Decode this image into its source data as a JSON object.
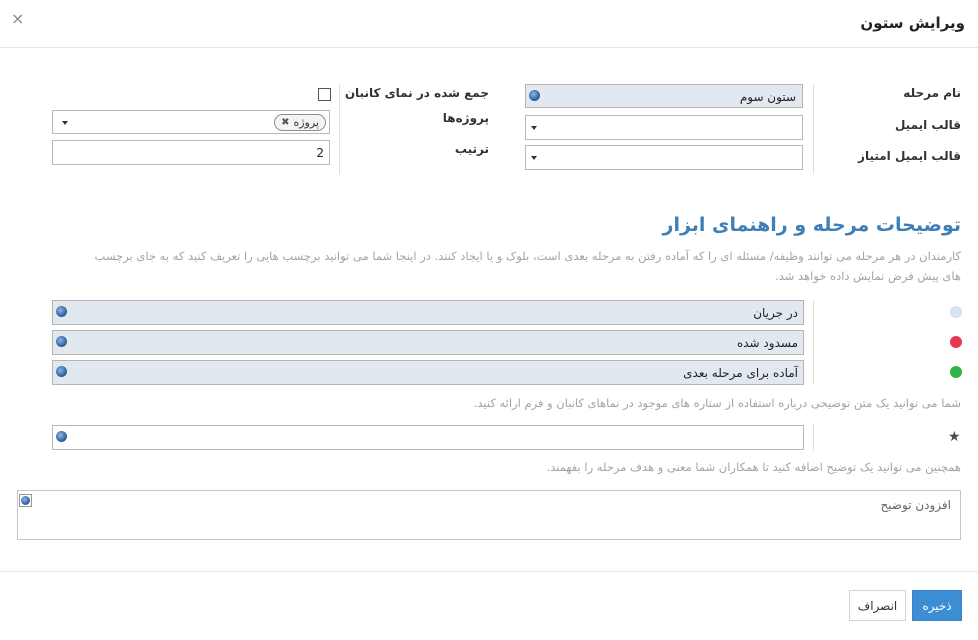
{
  "dialog": {
    "title": "ویرایش ستون",
    "close_symbol": "×"
  },
  "form": {
    "stage_name_label": "نام مرحله",
    "stage_name_value": "ستون سوم",
    "email_template_label": "قالب ایمیل",
    "rating_email_template_label": "قالب ایمیل امتیاز",
    "folded_label": "جمع شده در نمای کانبان",
    "projects_label": "پروژه‌ها",
    "projects_tag": "پروژه",
    "sequence_label": "ترتیب",
    "sequence_value": "2"
  },
  "section": {
    "title": "توضیحات مرحله و راهنمای ابزار",
    "help_line1": "کارمندان در هر مرحله می توانند وظیفه/ مسئله ای را که آماده رفتن به مرحله بعدی است، بلوک و یا ایجاد کنند. در اینجا شما می توانید برچسب هایی را تعریف کنید که به جای برچسب",
    "help_line2": "های پیش فرض نمایش داده خواهد شد."
  },
  "kanban_states": [
    {
      "label": "در جریان",
      "color": "#d5e3f3"
    },
    {
      "label": "مسدود شده",
      "color": "#e8384f"
    },
    {
      "label": "آماده برای مرحله بعدی",
      "color": "#2db34a"
    }
  ],
  "legend_help": "شما می توانید یک متن توضیحی درباره استفاده از ستاره های موجود در نماهای کانبان و فرم ارائه کنید.",
  "description_help": "همچنین می توانید یک توضیح اضافه کنید تا همکاران شما معنی و هدف مرحله را بفهمند.",
  "description_placeholder": "افزودن توضیح",
  "icons": {
    "globe": "globe-icon",
    "star": "star-icon",
    "caret": "caret-down-icon",
    "close": "close-icon"
  },
  "footer": {
    "save_label": "ذخیره",
    "cancel_label": "انصراف"
  }
}
